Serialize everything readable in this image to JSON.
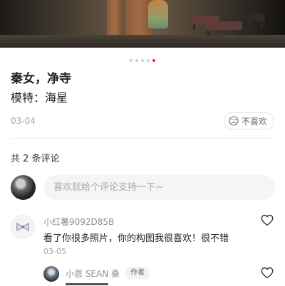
{
  "post": {
    "title": "秦女，净寺",
    "subtitle": "模特：海星",
    "date": "03-04",
    "dislike_label": "不喜欢",
    "carousel": {
      "total": 5,
      "active_index": 5
    }
  },
  "comments_section": {
    "count_label": "共 2 条评论",
    "input_placeholder": "喜欢就给个评论支持一下~",
    "comments": [
      {
        "author": "小红薯9092D85B",
        "text": "看了你很多照片，你的构图我很喜欢！很不错",
        "date": "03-05"
      }
    ],
    "reply": {
      "author": "小恩 SEAN 桑",
      "badge": "作者"
    }
  },
  "colors": {
    "accent": "#ff2442",
    "dot_inactive": "#cfcfcf",
    "muted_text": "#a6a6a6",
    "input_bg": "#f5f5f5"
  },
  "icons": {
    "dislike": "dislike-face-icon",
    "like": "heart-outline-icon",
    "comment_avatar": "bow-icon"
  }
}
